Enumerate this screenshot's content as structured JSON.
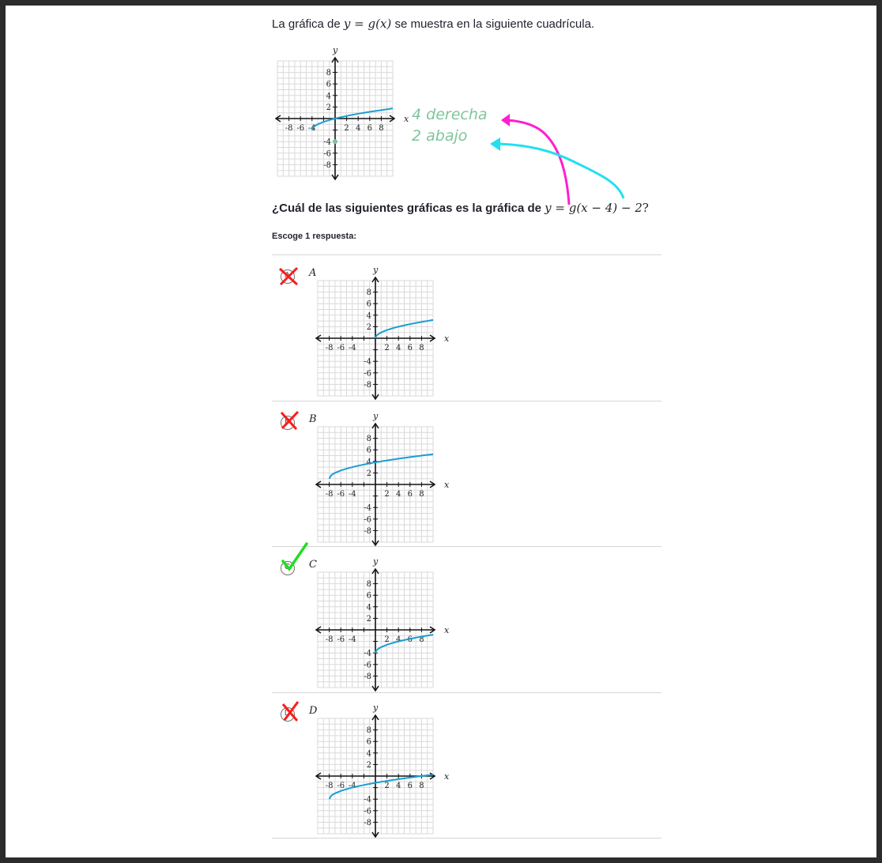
{
  "intro": {
    "before": "La gráfica de ",
    "eq_y": "y",
    "eq_eq": " = ",
    "eq_g": "g",
    "eq_x": "(x)",
    "after": " se muestra en la siguiente cuadrícula."
  },
  "question": {
    "before": "¿Cuál de las siguientes gráficas es la gráfica de ",
    "eq": "y = g(x − 4) − 2",
    "after": "?"
  },
  "instruction": "Escoge 1 respuesta:",
  "annotations": {
    "line1": "4 derecha",
    "line2": "2 abajo",
    "pink": "#ff1fd0",
    "cyan": "#22e0f0",
    "green_text": "#7fc59a"
  },
  "axes": {
    "x_label": "x",
    "y_label": "y",
    "x_ticks": [
      "-8",
      "-6",
      "-4",
      "2",
      "4",
      "6",
      "8"
    ],
    "y_ticks": [
      "8",
      "6",
      "4",
      "2",
      "-4",
      "-6",
      "-8"
    ],
    "curve_color": "#1a9ed1",
    "grid_color": "#d9d9d9"
  },
  "choices": [
    {
      "letter": "A",
      "mark": "wrong"
    },
    {
      "letter": "B",
      "mark": "wrong"
    },
    {
      "letter": "C",
      "mark": "correct"
    },
    {
      "letter": "D",
      "mark": "wrong"
    }
  ],
  "colors": {
    "wrong": "#ff1a1a",
    "correct": "#22dd22"
  }
}
